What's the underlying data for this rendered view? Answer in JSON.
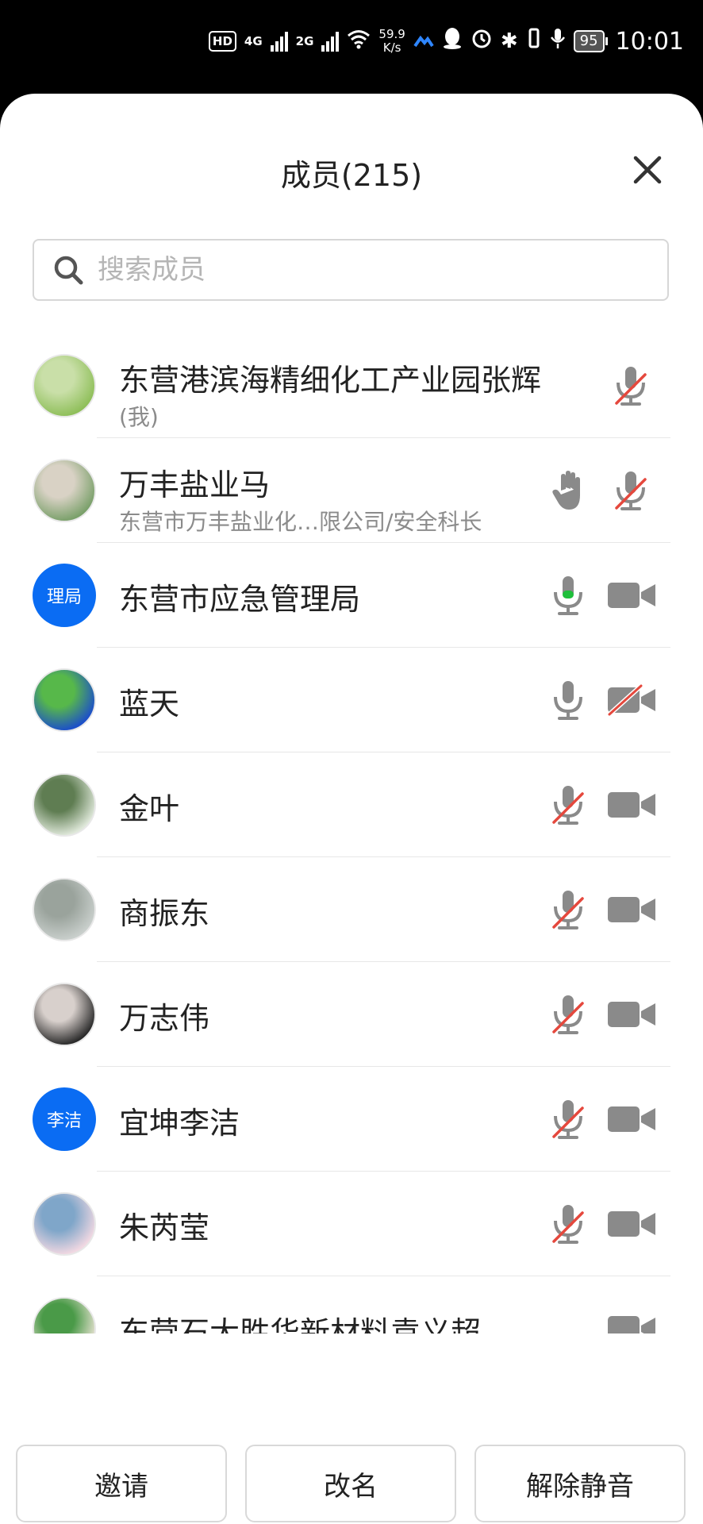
{
  "status_bar": {
    "hd": "HD",
    "sig1": "4G",
    "sig2": "2G",
    "net_speed": "59.9",
    "net_unit": "K/s",
    "battery": "95",
    "time": "10:01"
  },
  "header": {
    "title": "成员(215)"
  },
  "search": {
    "placeholder": "搜索成员"
  },
  "members": [
    {
      "name": "东营港滨海精细化工产业园张辉",
      "sub": "(我)",
      "avatar": "photo",
      "hand": false,
      "mic": "muted",
      "cam": "none"
    },
    {
      "name": "万丰盐业马",
      "sub": "东营市万丰盐业化…限公司/安全科长",
      "avatar": "photo",
      "hand": true,
      "mic": "muted",
      "cam": "none"
    },
    {
      "name": "东营市应急管理局",
      "sub": "",
      "avatar": "text",
      "avatar_text": "理局",
      "hand": false,
      "mic": "speaking",
      "cam": "on"
    },
    {
      "name": "蓝天",
      "sub": "",
      "avatar": "photo",
      "hand": false,
      "mic": "on",
      "cam": "off"
    },
    {
      "name": "金叶",
      "sub": "",
      "avatar": "photo",
      "hand": false,
      "mic": "muted",
      "cam": "on"
    },
    {
      "name": "商振东",
      "sub": "",
      "avatar": "photo",
      "hand": false,
      "mic": "muted",
      "cam": "on"
    },
    {
      "name": "万志伟",
      "sub": "",
      "avatar": "photo",
      "hand": false,
      "mic": "muted",
      "cam": "on"
    },
    {
      "name": "宜坤李洁",
      "sub": "",
      "avatar": "text",
      "avatar_text": "李洁",
      "hand": false,
      "mic": "muted",
      "cam": "on"
    },
    {
      "name": "朱芮莹",
      "sub": "",
      "avatar": "photo",
      "hand": false,
      "mic": "muted",
      "cam": "on"
    },
    {
      "name": "东营石大胜华新材料袁义超",
      "sub": "",
      "avatar": "photo",
      "hand": false,
      "mic": "none",
      "cam": "on"
    }
  ],
  "actions": {
    "invite": "邀请",
    "rename": "改名",
    "unmute": "解除静音"
  },
  "colors": {
    "accent": "#0a6cf3",
    "mute_slash": "#e5483d",
    "speaking": "#1fbf3b",
    "icon_gray": "#8a8a8a"
  }
}
